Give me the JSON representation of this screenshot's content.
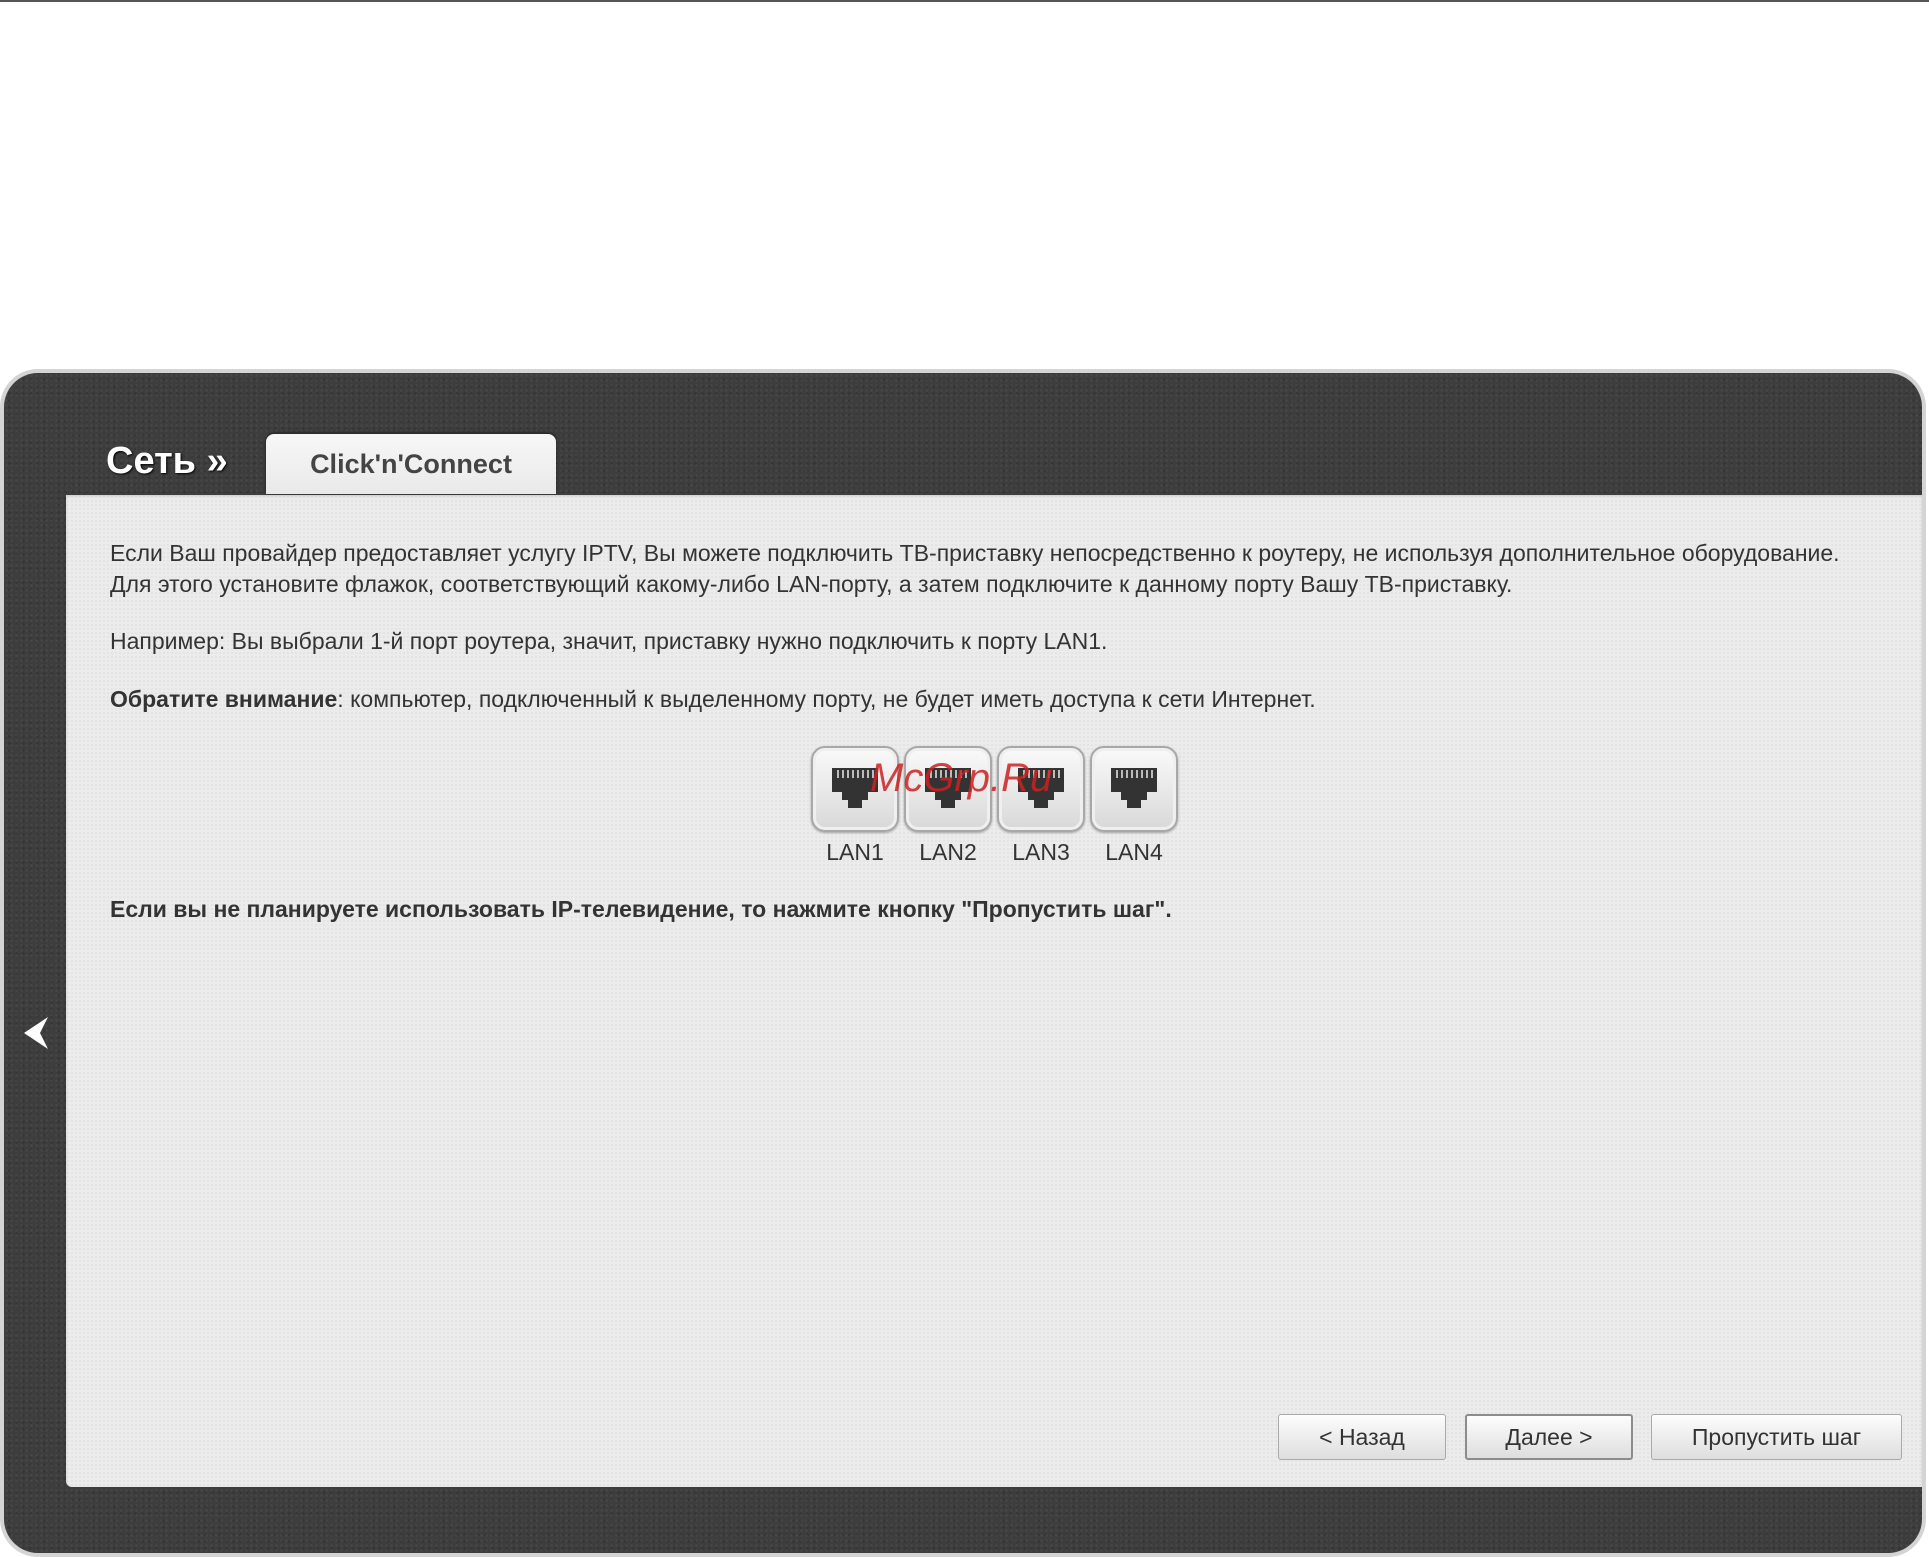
{
  "header": {
    "section_title": "Сеть »",
    "tab_label": "Click'n'Connect"
  },
  "main": {
    "paragraph1": "Если Ваш провайдер предоставляет услугу IPTV, Вы можете подключить ТВ-приставку непосредственно к роутеру, не используя дополнительное оборудование. Для этого установите флажок, соответствующий какому-либо LAN-порту, а затем подключите к данному порту Вашу ТВ-приставку.",
    "paragraph2": "Например: Вы выбрали 1-й порт роутера, значит, приставку нужно подключить к порту LAN1.",
    "notice_bold": "Обратите внимание",
    "notice_text": ": компьютер, подключенный к выделенному порту, не будет иметь доступа к сети Интернет.",
    "skip_hint": "Если вы не планируете использовать IP-телевидение, то нажмите кнопку \"Пропустить шаг\".",
    "ports": [
      {
        "label": "LAN1",
        "icon": "ethernet-port-icon"
      },
      {
        "label": "LAN2",
        "icon": "ethernet-port-icon"
      },
      {
        "label": "LAN3",
        "icon": "ethernet-port-icon"
      },
      {
        "label": "LAN4",
        "icon": "ethernet-port-icon"
      }
    ],
    "watermark": "McGrp.Ru"
  },
  "footer": {
    "back_label": "< Назад",
    "next_label": "Далее >",
    "skip_label": "Пропустить шаг"
  },
  "icons": {
    "side_nav": "chevron-left-icon"
  },
  "colors": {
    "frame": "#3d3d3d",
    "panel": "#ececec",
    "watermark": "#cc2222"
  }
}
